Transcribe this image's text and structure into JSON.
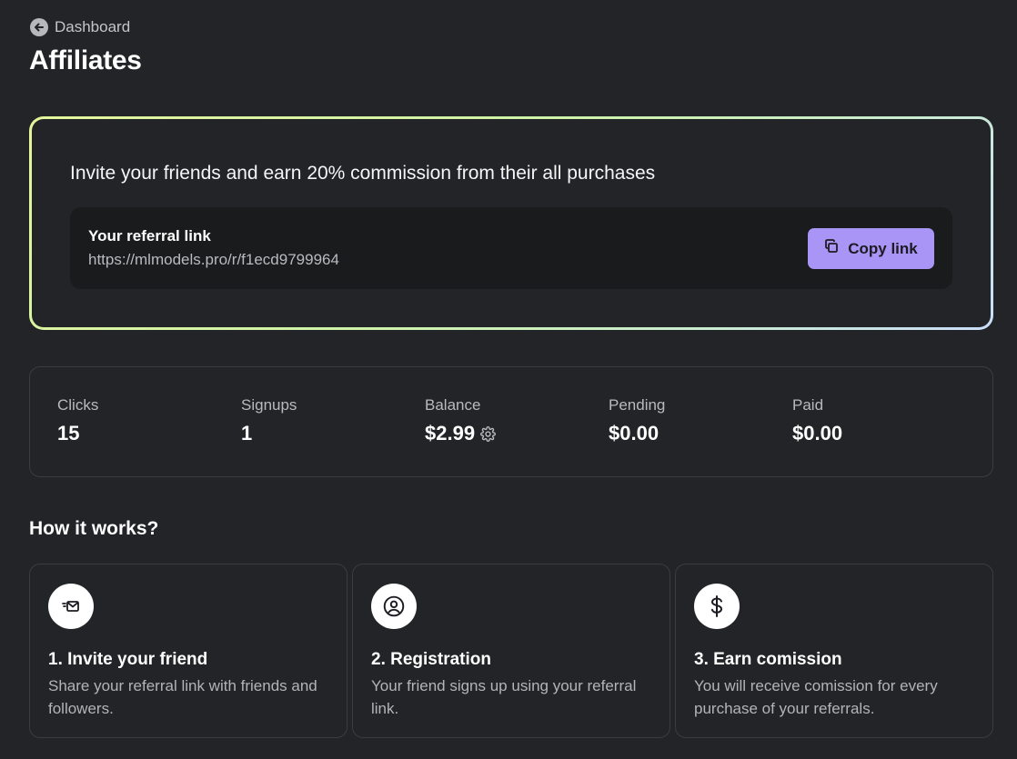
{
  "header": {
    "breadcrumb_label": "Dashboard",
    "page_title": "Affiliates"
  },
  "invite": {
    "headline": "Invite your friends and earn 20% commission from their all purchases",
    "referral_label": "Your referral link",
    "referral_url": "https://mlmodels.pro/r/f1ecd9799964",
    "copy_button_label": "Copy link"
  },
  "stats": [
    {
      "label": "Clicks",
      "value": "15"
    },
    {
      "label": "Signups",
      "value": "1"
    },
    {
      "label": "Balance",
      "value": "$2.99",
      "icon": "gear-icon"
    },
    {
      "label": "Pending",
      "value": "$0.00"
    },
    {
      "label": "Paid",
      "value": "$0.00"
    }
  ],
  "how_it_works": {
    "title": "How it works?",
    "steps": [
      {
        "title": "1. Invite your friend",
        "description": "Share your referral link with friends and followers.",
        "icon": "mail-send-icon"
      },
      {
        "title": "2. Registration",
        "description": "Your friend signs up using your referral link.",
        "icon": "user-circle-icon"
      },
      {
        "title": "3. Earn comission",
        "description": "You will receive comission for every purchase of your referrals.",
        "icon": "dollar-icon"
      }
    ]
  },
  "colors": {
    "background": "#232427",
    "accent_button": "#a895f6",
    "card_border_gradient": [
      "#e3f59a",
      "#c9defa"
    ]
  }
}
